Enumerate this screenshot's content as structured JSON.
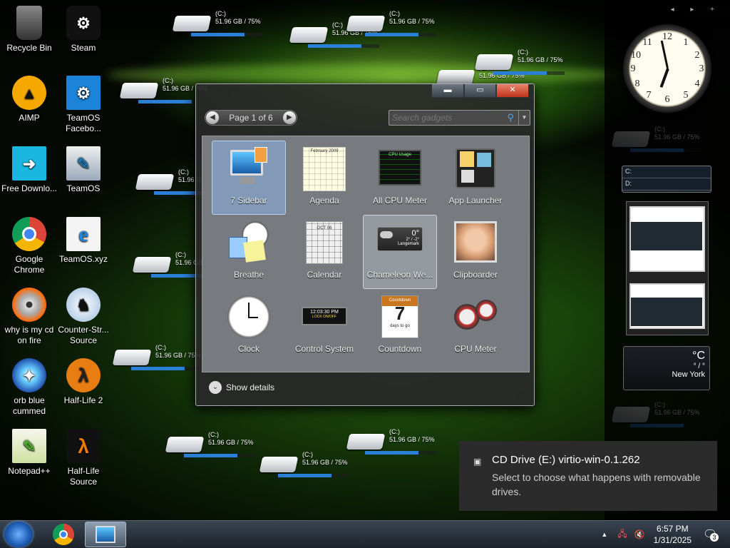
{
  "desktop_icons": [
    {
      "label": "Recycle Bin",
      "icon": "recycle-bin-icon"
    },
    {
      "label": "Steam",
      "icon": "steam-icon"
    },
    {
      "label": "AIMP",
      "icon": "aimp-icon"
    },
    {
      "label": "TeamOS Facebo...",
      "icon": "gear-icon"
    },
    {
      "label": "Free Downlo...",
      "icon": "download-icon"
    },
    {
      "label": "TeamOS",
      "icon": "folder-icon"
    },
    {
      "label": "Google Chrome",
      "icon": "chrome-icon"
    },
    {
      "label": "TeamOS.xyz",
      "icon": "internet-explorer-icon"
    },
    {
      "label": "why is my cd on fire",
      "icon": "burning-cd-icon"
    },
    {
      "label": "Counter-Str... Source",
      "icon": "counter-strike-icon"
    },
    {
      "label": "orb blue cummed",
      "icon": "orb-icon"
    },
    {
      "label": "Half-Life 2",
      "icon": "half-life-2-icon"
    },
    {
      "label": "Notepad++",
      "icon": "notepad-plus-plus-icon"
    },
    {
      "label": "Half-Life Source",
      "icon": "half-life-icon"
    }
  ],
  "drive_widget": {
    "label": "(C:)",
    "usage": "51.96 GB / 75%",
    "fill_pct": 75
  },
  "gallery": {
    "page_label": "Page 1 of 6",
    "search_placeholder": "Search gadgets",
    "show_details": "Show details",
    "gadgets": [
      {
        "label": "7 Sidebar",
        "icon": "monitor-icon",
        "selected": true
      },
      {
        "label": "Agenda",
        "icon": "calendar-icon"
      },
      {
        "label": "All CPU Meter",
        "icon": "cpu-meter-icon"
      },
      {
        "label": "App Launcher",
        "icon": "app-launcher-icon"
      },
      {
        "label": "Breathe",
        "icon": "clock-icon"
      },
      {
        "label": "Calendar",
        "icon": "calendar-icon"
      },
      {
        "label": "Chameleon We...",
        "icon": "weather-icon",
        "hover": true
      },
      {
        "label": "Clipboarder",
        "icon": "baby-photo-icon"
      },
      {
        "label": "Clock",
        "icon": "clock-icon"
      },
      {
        "label": "Control System",
        "icon": "digital-clock-icon"
      },
      {
        "label": "Countdown",
        "icon": "countdown-icon"
      },
      {
        "label": "CPU Meter",
        "icon": "gauge-icon"
      }
    ],
    "mini_texts": {
      "agenda": "February 2009",
      "cpu": "CPU Usage",
      "calendar": "OCT 06",
      "chameleon_temp": "0°",
      "chameleon_range": "2° / -2°",
      "chameleon_city": "Langemark",
      "digital_time": "12:03:30 PM",
      "digital_lock": "LOCK ON/OFF",
      "countdown_head": "Countdown",
      "countdown_num": "7",
      "countdown_sub": "days to go"
    }
  },
  "sidebar": {
    "nav": "◂ ▸ +",
    "net_rows": [
      "C:",
      "D:"
    ],
    "weather": {
      "temp": "°C",
      "range": "° / °",
      "city": "New York"
    }
  },
  "toast": {
    "title": "CD Drive (E:) virtio-win-0.1.262",
    "body": "Select to choose what happens with removable drives."
  },
  "taskbar": {
    "time": "6:57 PM",
    "date": "1/31/2025",
    "notif_count": "3"
  }
}
